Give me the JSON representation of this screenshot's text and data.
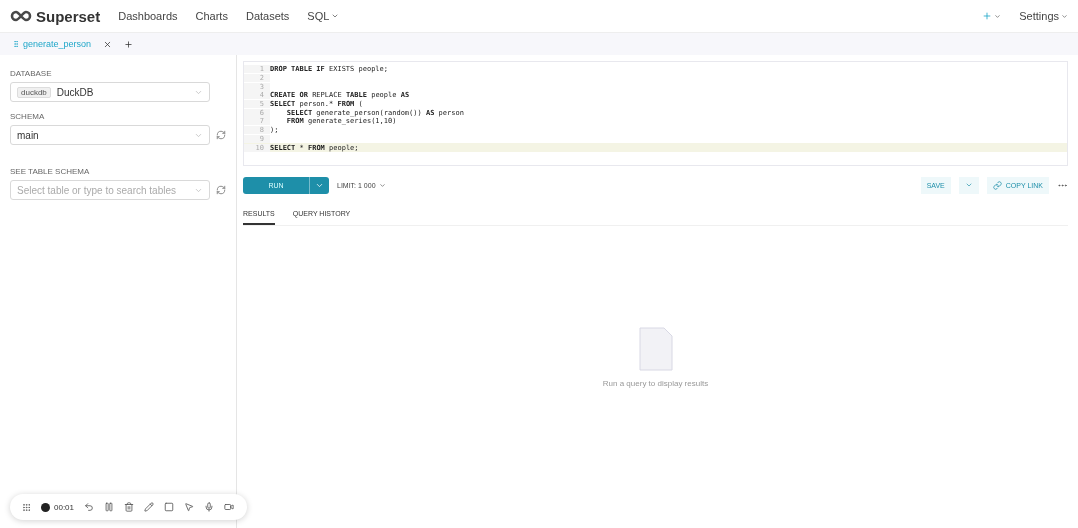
{
  "navbar": {
    "brand": "Superset",
    "menu": [
      {
        "label": "Dashboards",
        "dropdown": false
      },
      {
        "label": "Charts",
        "dropdown": false
      },
      {
        "label": "Datasets",
        "dropdown": false
      },
      {
        "label": "SQL",
        "dropdown": true
      }
    ],
    "right": [
      {
        "label": "Settings"
      }
    ]
  },
  "query_tabs": [
    {
      "label": "generate_person",
      "selected": true
    }
  ],
  "sidebar": {
    "database": {
      "label": "DATABASE",
      "tag": "duckdb",
      "value": "DuckDB"
    },
    "schema": {
      "label": "SCHEMA",
      "value": "main"
    },
    "table": {
      "label": "SEE TABLE SCHEMA",
      "placeholder": "Select table or type to search tables"
    }
  },
  "editor": {
    "lines": [
      {
        "number": "1",
        "code": "**DROP TABLE IF** EXISTS people;",
        "active": false
      },
      {
        "number": "2",
        "active": false
      },
      {
        "number": "3",
        "active": false
      },
      {
        "number": "4",
        "code": "**CREATE OR** REPLACE **TABLE** people **AS**",
        "active": false
      },
      {
        "number": "5",
        "code": "**SELECT** person.* **FROM** (",
        "active": false
      },
      {
        "number": "6",
        "code": "    **SELECT** generate_person(random()) **AS** person",
        "active": false
      },
      {
        "number": "7",
        "code": "    **FROM** generate_series(1,10)",
        "active": false
      },
      {
        "number": "8",
        "code": ");",
        "active": false
      },
      {
        "number": "9",
        "active": false
      },
      {
        "number": "10",
        "code": "**SELECT** * **FROM** people;",
        "active": true
      }
    ]
  },
  "toolbar": {
    "run": "RUN",
    "limit": "LIMIT: 1 000",
    "save": "SAVE",
    "copy_link": "COPY LINK"
  },
  "result_tabs": [
    {
      "label": "RESULTS",
      "selected": true
    },
    {
      "label": "QUERY HISTORY",
      "selected": false
    }
  ],
  "empty_state": {
    "message": "Run a query to display results"
  },
  "recorder": {
    "time": "00:01"
  }
}
